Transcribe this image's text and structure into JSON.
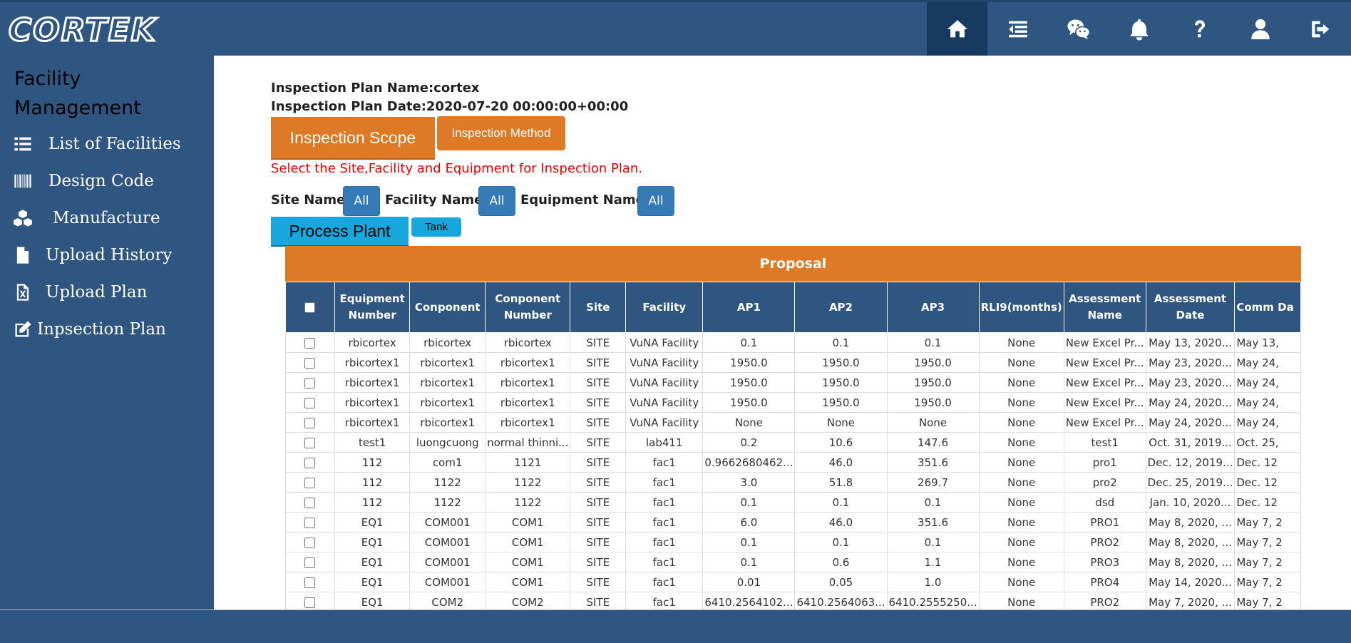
{
  "header": {
    "logo_text": "CORTEK",
    "icons": [
      "home-icon",
      "menu-collapse-icon",
      "wechat-icon",
      "bell-icon",
      "question-icon",
      "user-icon",
      "logout-icon"
    ]
  },
  "sidebar": {
    "title": "Facility Management",
    "items": [
      {
        "label": "List of Facilities",
        "icon": "list-icon"
      },
      {
        "label": "Design Code",
        "icon": "barcode-icon"
      },
      {
        "label": "Manufacture",
        "icon": "cubes-icon"
      },
      {
        "label": "Upload History",
        "icon": "file-icon"
      },
      {
        "label": "Upload Plan",
        "icon": "excel-file-icon"
      },
      {
        "label": "Inpsection Plan",
        "icon": "edit-icon"
      }
    ]
  },
  "plan": {
    "name_line": "Inspection Plan Name:cortex",
    "date_line": "Inspection Plan Date:2020-07-20 00:00:00+00:00"
  },
  "tabs": {
    "scope": "Inspection Scope",
    "method": "Inspection Method"
  },
  "hint": "Select the Site,Facility and Equipment for Inspection Plan.",
  "filters": {
    "site_label": "Site Name:",
    "site_value": "All",
    "facility_label": "Facility Name:",
    "facility_value": "All",
    "equipment_label": "Equipment Name:",
    "equipment_value": "All"
  },
  "subtabs": {
    "process_plant": "Process Plant",
    "tank": "Tank"
  },
  "table": {
    "banner": "Proposal",
    "columns": [
      "",
      "Equipment Number",
      "Conponent",
      "Conponent Number",
      "Site",
      "Facility",
      "AP1",
      "AP2",
      "AP3",
      "RLI9(months)",
      "Assessment Name",
      "Assessment Date",
      "Comm Da"
    ],
    "rows": [
      [
        "rbicortex",
        "rbicortex",
        "rbicortex",
        "SITE",
        "VuNA Facility",
        "0.1",
        "0.1",
        "0.1",
        "None",
        "New Excel Pr...",
        "May 13, 2020...",
        "May 13,"
      ],
      [
        "rbicortex1",
        "rbicortex1",
        "rbicortex1",
        "SITE",
        "VuNA Facility",
        "1950.0",
        "1950.0",
        "1950.0",
        "None",
        "New Excel Pr...",
        "May 23, 2020...",
        "May 24,"
      ],
      [
        "rbicortex1",
        "rbicortex1",
        "rbicortex1",
        "SITE",
        "VuNA Facility",
        "1950.0",
        "1950.0",
        "1950.0",
        "None",
        "New Excel Pr...",
        "May 23, 2020...",
        "May 24,"
      ],
      [
        "rbicortex1",
        "rbicortex1",
        "rbicortex1",
        "SITE",
        "VuNA Facility",
        "1950.0",
        "1950.0",
        "1950.0",
        "None",
        "New Excel Pr...",
        "May 24, 2020...",
        "May 24,"
      ],
      [
        "rbicortex1",
        "rbicortex1",
        "rbicortex1",
        "SITE",
        "VuNA Facility",
        "None",
        "None",
        "None",
        "None",
        "New Excel Pr...",
        "May 24, 2020...",
        "May 24,"
      ],
      [
        "test1",
        "luongcuong",
        "normal thinni...",
        "SITE",
        "lab411",
        "0.2",
        "10.6",
        "147.6",
        "None",
        "test1",
        "Oct. 31, 2019...",
        "Oct. 25,"
      ],
      [
        "112",
        "com1",
        "1121",
        "SITE",
        "fac1",
        "0.9662680462...",
        "46.0",
        "351.6",
        "None",
        "pro1",
        "Dec. 12, 2019...",
        "Dec. 12"
      ],
      [
        "112",
        "1122",
        "1122",
        "SITE",
        "fac1",
        "3.0",
        "51.8",
        "269.7",
        "None",
        "pro2",
        "Dec. 25, 2019...",
        "Dec. 12"
      ],
      [
        "112",
        "1122",
        "1122",
        "SITE",
        "fac1",
        "0.1",
        "0.1",
        "0.1",
        "None",
        "dsd",
        "Jan. 10, 2020...",
        "Dec. 12"
      ],
      [
        "EQ1",
        "COM001",
        "COM1",
        "SITE",
        "fac1",
        "6.0",
        "46.0",
        "351.6",
        "None",
        "PRO1",
        "May 8, 2020, ...",
        "May 7, 2"
      ],
      [
        "EQ1",
        "COM001",
        "COM1",
        "SITE",
        "fac1",
        "0.1",
        "0.1",
        "0.1",
        "None",
        "PRO2",
        "May 8, 2020, ...",
        "May 7, 2"
      ],
      [
        "EQ1",
        "COM001",
        "COM1",
        "SITE",
        "fac1",
        "0.1",
        "0.6",
        "1.1",
        "None",
        "PRO3",
        "May 8, 2020, ...",
        "May 7, 2"
      ],
      [
        "EQ1",
        "COM001",
        "COM1",
        "SITE",
        "fac1",
        "0.01",
        "0.05",
        "1.0",
        "None",
        "PRO4",
        "May 14, 2020...",
        "May 7, 2"
      ],
      [
        "EQ1",
        "COM2",
        "COM2",
        "SITE",
        "fac1",
        "6410.2564102...",
        "6410.2564063...",
        "6410.2555250...",
        "None",
        "PRO2",
        "May 7, 2020, ...",
        "May 7, 2"
      ]
    ]
  },
  "colors": {
    "nav_blue": "#2f5581",
    "active_nav": "#15395f",
    "orange": "#de7a25",
    "cyan": "#18a7dd",
    "filter_blue": "#337ab7",
    "hint_red": "#e60000"
  }
}
